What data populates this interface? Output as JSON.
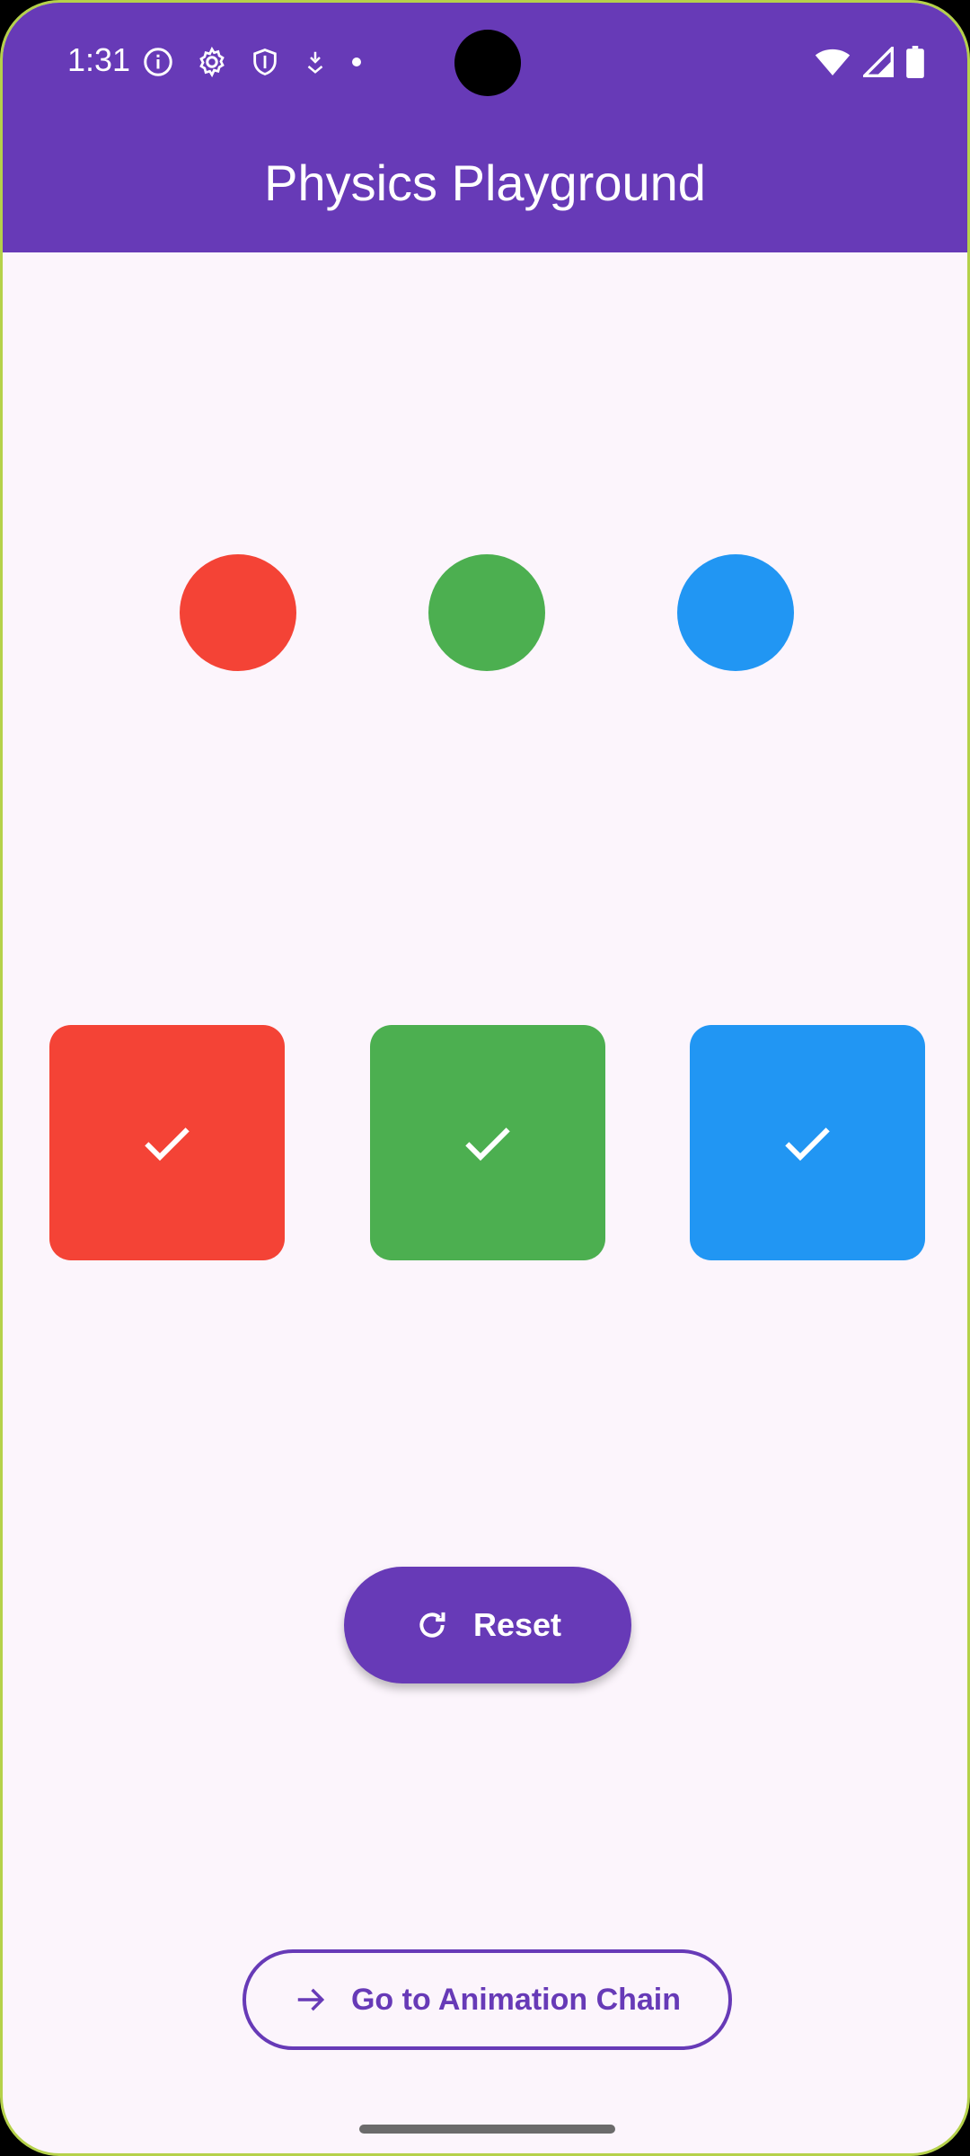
{
  "status_bar": {
    "time": "1:31",
    "icons": [
      "info-icon",
      "settings-icon",
      "shield-icon",
      "download-icon",
      "dot-icon"
    ],
    "right_icons": [
      "wifi-icon",
      "signal-icon",
      "battery-icon"
    ]
  },
  "app_bar": {
    "title": "Physics Playground"
  },
  "colors": {
    "primary": "#673ab7",
    "background": "#fcf5fc",
    "red": "#f44336",
    "green": "#4caf50",
    "blue": "#2196f3"
  },
  "circles": [
    {
      "color": "#f44336",
      "name": "red"
    },
    {
      "color": "#4caf50",
      "name": "green"
    },
    {
      "color": "#2196f3",
      "name": "blue"
    }
  ],
  "targets": [
    {
      "color": "#f44336",
      "icon": "check-icon",
      "state": "matched"
    },
    {
      "color": "#4caf50",
      "icon": "check-icon",
      "state": "matched"
    },
    {
      "color": "#2196f3",
      "icon": "check-icon",
      "state": "matched"
    }
  ],
  "actions": {
    "reset_label": "Reset",
    "reset_icon": "refresh-icon",
    "navigate_label": "Go to Animation Chain",
    "navigate_icon": "arrow-right-icon"
  }
}
